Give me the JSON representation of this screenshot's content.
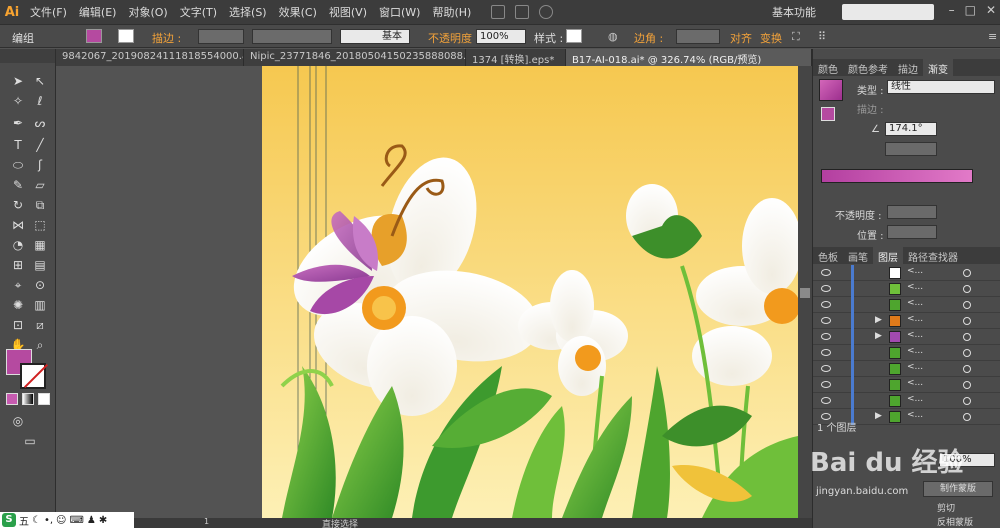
{
  "app": {
    "logo": "Ai"
  },
  "menubar": {
    "items": [
      "文件(F)",
      "编辑(E)",
      "对象(O)",
      "文字(T)",
      "选择(S)",
      "效果(C)",
      "视图(V)",
      "窗口(W)",
      "帮助(H)"
    ],
    "workspace": "基本功能"
  },
  "controlbar": {
    "selection_label": "编组",
    "stroke_label": "描边 :",
    "stroke_style": "基本",
    "opacity_label": "不透明度 :",
    "opacity_value": "100%",
    "style_label": "样式 :",
    "corner_label": "边角 :",
    "align_label": "对齐",
    "transform_label": "变换"
  },
  "tabs": [
    {
      "label": "9842067_20190824111818554000.ai*",
      "active": false
    },
    {
      "label": "Nipic_23771846_20180504150235888088.ai*",
      "active": false
    },
    {
      "label": "1374 [转换].eps*",
      "active": false
    },
    {
      "label": "B17-AI-018.ai* @ 326.74% (RGB/预览)",
      "active": true
    }
  ],
  "right_panel": {
    "top_tabs": [
      "颜色",
      "颜色参考",
      "描边",
      "渐变"
    ],
    "active_top_tab": "渐变",
    "type_label": "类型 :",
    "type_value": "线性",
    "stroke_label": "描边 :",
    "angle_value": "174.1°",
    "opacity_label": "不透明度 :",
    "position_label": "位置 :",
    "layer_tabs": [
      "色板",
      "画笔",
      "图层",
      "路径查找器"
    ],
    "active_layer_tab": "图层",
    "layer_count": "1 个图层",
    "opacity_small": "100%",
    "make_mask": "制作蒙版",
    "clip_label": "剪切",
    "invert_label": "反相蒙版",
    "gradient_colors": {
      "start": "#b33fa0",
      "end": "#e27ac8"
    },
    "layers": [
      {
        "name": "<...",
        "has_arrow": false,
        "thumb": "#ffffff"
      },
      {
        "name": "<...",
        "has_arrow": false,
        "thumb": "#6fbf3a"
      },
      {
        "name": "<...",
        "has_arrow": false,
        "thumb": "#4ea52e"
      },
      {
        "name": "<...",
        "has_arrow": true,
        "thumb": "#e07a1a"
      },
      {
        "name": "<...",
        "has_arrow": true,
        "thumb": "#a24ab0"
      },
      {
        "name": "<...",
        "has_arrow": false,
        "thumb": "#4ea52e"
      },
      {
        "name": "<...",
        "has_arrow": false,
        "thumb": "#4ea52e"
      },
      {
        "name": "<...",
        "has_arrow": false,
        "thumb": "#4ea52e"
      },
      {
        "name": "<...",
        "has_arrow": false,
        "thumb": "#4ea52e"
      },
      {
        "name": "<...",
        "has_arrow": true,
        "thumb": "#4ea52e"
      }
    ]
  },
  "statusbar": {
    "zoom_page": "1",
    "status": "直接选择"
  },
  "watermark": {
    "brand": "Bai du 经验",
    "url": "jingyan.baidu.com"
  },
  "taskbar": {
    "label": "五"
  },
  "colors": {
    "accent_orange": "#f2a23a",
    "fill_swatch": "#b54aa0",
    "artboard_top": "#f6c850",
    "artboard_bottom": "#fdf0b5"
  }
}
